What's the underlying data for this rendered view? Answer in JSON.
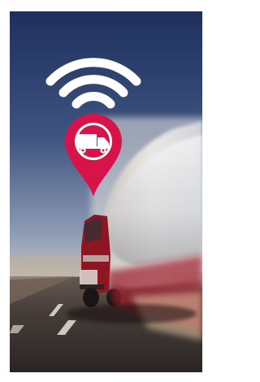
{
  "scene": {
    "subject": "tanker-truck-on-highway",
    "icons": [
      "wifi-icon",
      "location-pin-icon",
      "truck-icon"
    ],
    "colors": {
      "sky_top": "#1e2f5c",
      "sky_mid": "#6a7c9e",
      "sky_horizon": "#d8d2c6",
      "road": "#3a3431",
      "pin_red": "#d6144a",
      "icon_white": "#ffffff",
      "truck_red": "#8e1622",
      "tank_silver": "#d8d9dd"
    }
  }
}
